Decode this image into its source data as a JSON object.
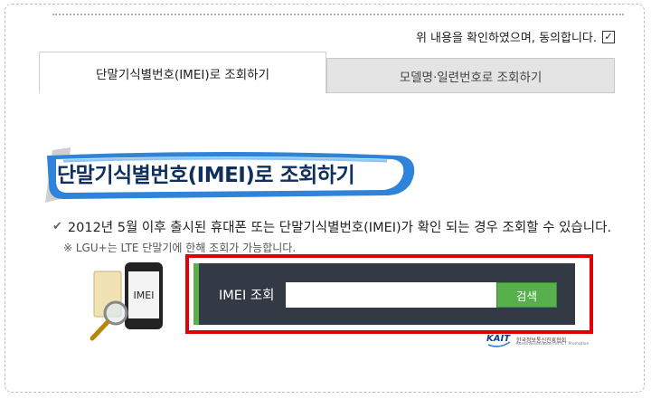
{
  "agree": {
    "text": "위 내용을 확인하였으며, 동의합니다.",
    "checked_mark": "✓"
  },
  "tabs": [
    {
      "label": "단말기식별번호(IMEI)로 조회하기",
      "active": true
    },
    {
      "label": "모델명·일련번호로 조회하기",
      "active": false
    }
  ],
  "section": {
    "title": "단말기식별번호(IMEI)로 조회하기",
    "notice": "2012년 5월 이후 출시된 휴대폰 또는 단말기식별번호(IMEI)가 확인 되는 경우 조회할 수 있습니다.",
    "notice_mark": "✔",
    "sub_note": "※ LGU+는 LTE 단말기에 한해 조회가 가능합니다.",
    "phone_label": "IMEI"
  },
  "search": {
    "label": "IMEI 조회",
    "value": "",
    "button": "검색"
  },
  "logo": {
    "name": "KAIT",
    "org_kr": "한국정보통신진흥협회",
    "org_en": "Korea Association for ICT Promotion"
  },
  "colors": {
    "accent_green": "#58b04d",
    "panel_dark": "#343946",
    "highlight_red": "#e10000",
    "title_navy": "#0f2f5c"
  }
}
